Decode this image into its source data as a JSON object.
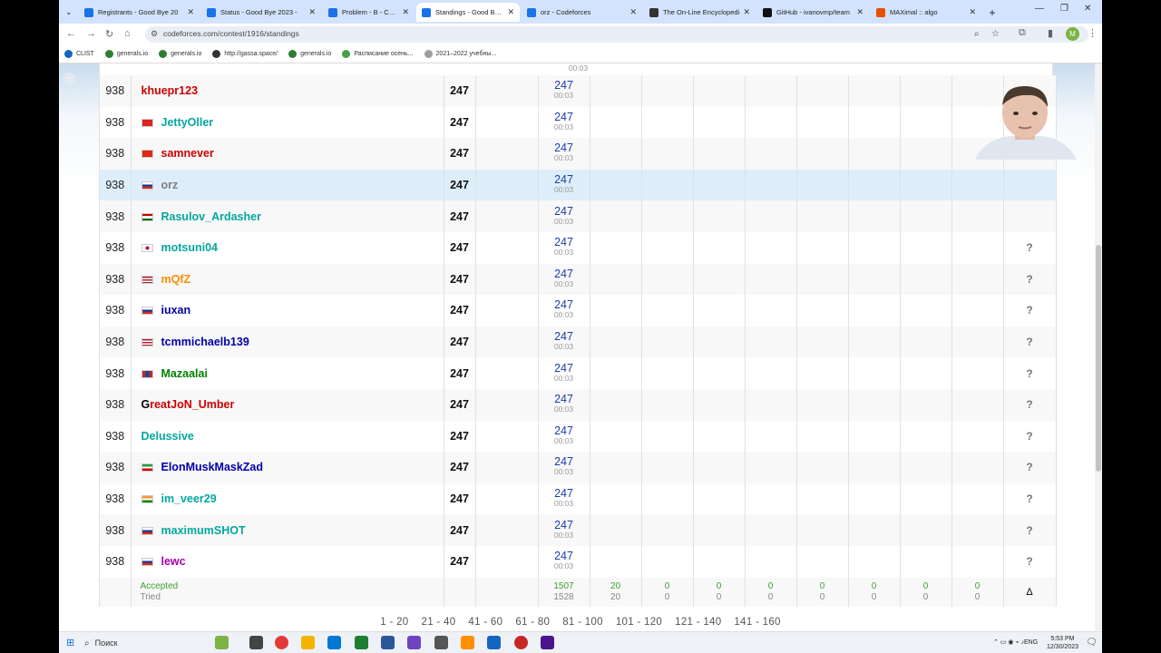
{
  "browser": {
    "tabs": [
      {
        "title": "Registrants - Good Bye 20",
        "icon": "codeforces-icon",
        "active": false
      },
      {
        "title": "Status - Good Bye 2023 -",
        "icon": "codeforces-icon",
        "active": false
      },
      {
        "title": "Problem - B - Codeforces",
        "icon": "codeforces-icon",
        "active": false
      },
      {
        "title": "Standings - Good Bye 20",
        "icon": "codeforces-icon",
        "active": true
      },
      {
        "title": "orz - Codeforces",
        "icon": "codeforces-icon",
        "active": false
      },
      {
        "title": "The On-Line Encyclopedi",
        "icon": "oeis-icon",
        "active": false
      },
      {
        "title": "GitHub - ivanovmp/team",
        "icon": "github-icon",
        "active": false
      },
      {
        "title": "MAXimal :: algo",
        "icon": "maximal-icon",
        "active": false
      }
    ],
    "url": "codeforces.com/contest/1916/standings",
    "profile_initial": "M",
    "bookmarks": [
      "CLIST",
      "generals.io",
      "generals.io",
      "http://gassa.space/",
      "generals.io",
      "Расписание осень...",
      "2021–2022 учебны..."
    ]
  },
  "standings": {
    "partial_time": "00:03",
    "rows": [
      {
        "rank": "938",
        "handle": "khuepr123",
        "color": "#cc0000",
        "flag": "none",
        "points": "247",
        "b_score": "247",
        "b_time": "00:03",
        "last": "?",
        "highlight": false
      },
      {
        "rank": "938",
        "handle": "JettyOller",
        "color": "#03a89e",
        "flag": "vn",
        "points": "247",
        "b_score": "247",
        "b_time": "00:03",
        "last": "?",
        "highlight": false
      },
      {
        "rank": "938",
        "handle": "samnever",
        "color": "#cc0000",
        "flag": "cn",
        "points": "247",
        "b_score": "247",
        "b_time": "00:03",
        "last": "?",
        "highlight": false
      },
      {
        "rank": "938",
        "handle": "orz",
        "color": "#808080",
        "flag": "ru",
        "points": "247",
        "b_score": "247",
        "b_time": "00:03",
        "last": "",
        "highlight": true
      },
      {
        "rank": "938",
        "handle": "Rasulov_Ardasher",
        "color": "#03a89e",
        "flag": "tj",
        "points": "247",
        "b_score": "247",
        "b_time": "00:03",
        "last": "",
        "highlight": false
      },
      {
        "rank": "938",
        "handle": "motsuni04",
        "color": "#03a89e",
        "flag": "kr",
        "points": "247",
        "b_score": "247",
        "b_time": "00:03",
        "last": "?",
        "highlight": false
      },
      {
        "rank": "938",
        "handle": "mQfZ",
        "color": "#ff8c00",
        "flag": "us",
        "points": "247",
        "b_score": "247",
        "b_time": "00:03",
        "last": "?",
        "highlight": false
      },
      {
        "rank": "938",
        "handle": "iuxan",
        "color": "#0000aa",
        "flag": "ru",
        "points": "247",
        "b_score": "247",
        "b_time": "00:03",
        "last": "?",
        "highlight": false
      },
      {
        "rank": "938",
        "handle": "tcmmichaelb139",
        "color": "#0000aa",
        "flag": "us",
        "points": "247",
        "b_score": "247",
        "b_time": "00:03",
        "last": "?",
        "highlight": false
      },
      {
        "rank": "938",
        "handle": "Mazaalai",
        "color": "#008000",
        "flag": "mn",
        "points": "247",
        "b_score": "247",
        "b_time": "00:03",
        "last": "?",
        "highlight": false
      },
      {
        "rank": "938",
        "handle": "GreatJoN_Umber",
        "color": "#cc0000",
        "first_black": "G",
        "flag": "none",
        "points": "247",
        "b_score": "247",
        "b_time": "00:03",
        "last": "?",
        "highlight": false
      },
      {
        "rank": "938",
        "handle": "Delussive",
        "color": "#03a89e",
        "flag": "none",
        "points": "247",
        "b_score": "247",
        "b_time": "00:03",
        "last": "?",
        "highlight": false
      },
      {
        "rank": "938",
        "handle": "ElonMuskMaskZad",
        "color": "#0000aa",
        "flag": "ir",
        "points": "247",
        "b_score": "247",
        "b_time": "00:03",
        "last": "?",
        "highlight": false
      },
      {
        "rank": "938",
        "handle": "im_veer29",
        "color": "#03a89e",
        "flag": "in",
        "points": "247",
        "b_score": "247",
        "b_time": "00:03",
        "last": "?",
        "highlight": false
      },
      {
        "rank": "938",
        "handle": "maximumSHOT",
        "color": "#03a89e",
        "flag": "ru",
        "points": "247",
        "b_score": "247",
        "b_time": "00:03",
        "last": "?",
        "highlight": false
      },
      {
        "rank": "938",
        "handle": "lewc",
        "color": "#aa00aa",
        "flag": "ru",
        "points": "247",
        "b_score": "247",
        "b_time": "00:03",
        "last": "?",
        "highlight": false
      }
    ],
    "summary": {
      "accepted_label": "Accepted",
      "tried_label": "Tried",
      "accepted": [
        "1507",
        "20",
        "0",
        "0",
        "0",
        "0",
        "0",
        "0",
        "0"
      ],
      "tried": [
        "1528",
        "20",
        "0",
        "0",
        "0",
        "0",
        "0",
        "0",
        "0"
      ],
      "toggle": "Δ"
    },
    "pages": [
      "1 - 20",
      "21 - 40",
      "41 - 60",
      "61 - 80",
      "81 - 100",
      "101 - 120",
      "121 - 140",
      "141 - 160"
    ]
  },
  "taskbar": {
    "search_label": "Поиск",
    "language": "ENG",
    "time": "5:53 PM",
    "date": "12/30/2023"
  },
  "colors": {
    "tab_strip": "#d3e3fd",
    "highlight_row": "#ddeefa",
    "problem_score": "#1d3ea8",
    "accepted": "#3ca02f"
  }
}
